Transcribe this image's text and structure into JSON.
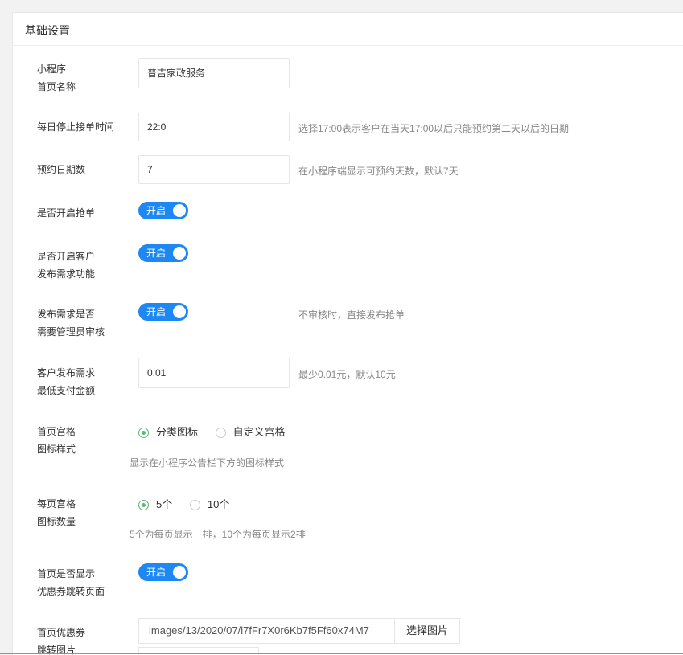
{
  "panel": {
    "title": "基础设置"
  },
  "fields": {
    "name": {
      "label1": "小程序",
      "label2": "首页名称",
      "value": "普吉家政服务"
    },
    "stop_time": {
      "label": "每日停止接单时间",
      "value": "22:0",
      "hint": "选择17:00表示客户在当天17:00以后只能预约第二天以后的日期"
    },
    "days": {
      "label": "预约日期数",
      "value": "7",
      "hint": "在小程序端显示可预约天数，默认7天"
    },
    "grab": {
      "label": "是否开启抢单",
      "toggle": "开启"
    },
    "publish": {
      "label1": "是否开启客户",
      "label2": "发布需求功能",
      "toggle": "开启"
    },
    "review": {
      "label1": "发布需求是否",
      "label2": "需要管理员审核",
      "toggle": "开启",
      "hint": "不审核时，直接发布抢单"
    },
    "min_pay": {
      "label1": "客户发布需求",
      "label2": "最低支付金额",
      "value": "0.01",
      "hint": "最少0.01元，默认10元"
    },
    "grid_style": {
      "label1": "首页宫格",
      "label2": "图标样式",
      "option1": "分类图标",
      "option2": "自定义宫格",
      "selected": "分类图标",
      "hint": "显示在小程序公告栏下方的图标样式"
    },
    "grid_count": {
      "label1": "每页宫格",
      "label2": "图标数量",
      "option1": "5个",
      "option2": "10个",
      "selected": "5个",
      "hint": "5个为每页显示一排，10个为每页显示2排"
    },
    "coupon": {
      "label1": "首页是否显示",
      "label2": "优惠券跳转页面",
      "toggle": "开启"
    },
    "coupon_img": {
      "label1": "首页优惠券",
      "label2": "跳转图片",
      "path": "images/13/2020/07/l7fFr7X0r6Kb7f5Ff60x74M7",
      "button": "选择图片"
    }
  },
  "colors": {
    "toggle_on": "#1e88f2",
    "radio_checked": "#5fb878",
    "bottom_accent": "#1fc7b5"
  }
}
